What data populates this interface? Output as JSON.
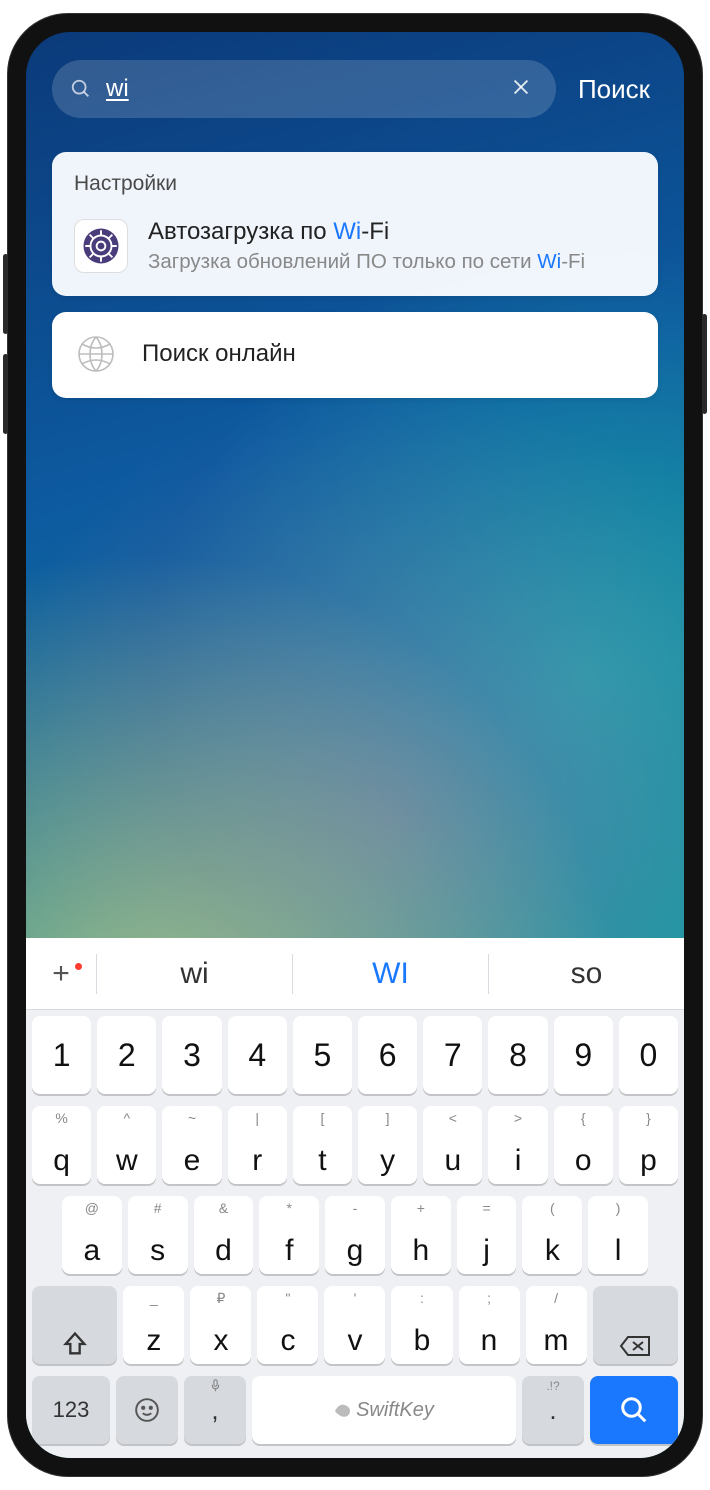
{
  "search": {
    "query": "wi",
    "action_label": "Поиск"
  },
  "results": {
    "section_header": "Настройки",
    "item": {
      "title_pre": "Автозагрузка по ",
      "title_hl": "Wi",
      "title_post": "-Fi",
      "sub_pre": "Загрузка обновлений ПО только по сети ",
      "sub_hl": "Wi",
      "sub_post": "-Fi"
    },
    "online_search": "Поиск онлайн"
  },
  "suggestions": {
    "s1": "wi",
    "s2": "WI",
    "s3": "so"
  },
  "keyboard": {
    "numbers": [
      "1",
      "2",
      "3",
      "4",
      "5",
      "6",
      "7",
      "8",
      "9",
      "0"
    ],
    "row1": [
      {
        "alt": "%",
        "main": "q"
      },
      {
        "alt": "^",
        "main": "w"
      },
      {
        "alt": "~",
        "main": "e"
      },
      {
        "alt": "|",
        "main": "r"
      },
      {
        "alt": "[",
        "main": "t"
      },
      {
        "alt": "]",
        "main": "y"
      },
      {
        "alt": "<",
        "main": "u"
      },
      {
        "alt": ">",
        "main": "i"
      },
      {
        "alt": "{",
        "main": "o"
      },
      {
        "alt": "}",
        "main": "p"
      }
    ],
    "row2": [
      {
        "alt": "@",
        "main": "a"
      },
      {
        "alt": "#",
        "main": "s"
      },
      {
        "alt": "&",
        "main": "d"
      },
      {
        "alt": "*",
        "main": "f"
      },
      {
        "alt": "-",
        "main": "g"
      },
      {
        "alt": "+",
        "main": "h"
      },
      {
        "alt": "=",
        "main": "j"
      },
      {
        "alt": "(",
        "main": "k"
      },
      {
        "alt": ")",
        "main": "l"
      }
    ],
    "row3": [
      {
        "alt": "_",
        "main": "z"
      },
      {
        "alt": "₽",
        "main": "x"
      },
      {
        "alt": "\"",
        "main": "c"
      },
      {
        "alt": "'",
        "main": "v"
      },
      {
        "alt": ":",
        "main": "b"
      },
      {
        "alt": ";",
        "main": "n"
      },
      {
        "alt": "/",
        "main": "m"
      }
    ],
    "bottom": {
      "symbols": "123",
      "comma": ",",
      "space_brand": "SwiftKey",
      "period": ".",
      "period_alt": ".!?"
    }
  }
}
